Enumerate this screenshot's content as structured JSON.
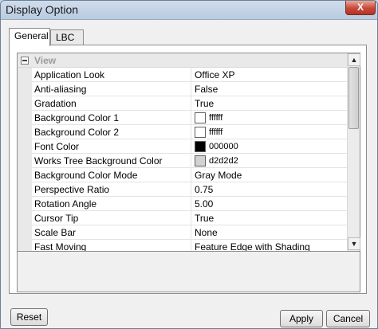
{
  "window": {
    "title": "Display Option",
    "close_label": "X"
  },
  "tabs": [
    {
      "label": "General",
      "active": true
    },
    {
      "label": "LBC",
      "active": false
    }
  ],
  "category": {
    "toggle": "-",
    "label": "View"
  },
  "properties": [
    {
      "name": "Application Look",
      "value": "Office XP"
    },
    {
      "name": "Anti-aliasing",
      "value": "False"
    },
    {
      "name": "Gradation",
      "value": "True"
    },
    {
      "name": "Background Color 1",
      "value": "ffffff",
      "color": "#ffffff"
    },
    {
      "name": "Background Color 2",
      "value": "ffffff",
      "color": "#ffffff"
    },
    {
      "name": "Font Color",
      "value": "000000",
      "color": "#000000"
    },
    {
      "name": "Works Tree Background Color",
      "value": "d2d2d2",
      "color": "#d2d2d2"
    },
    {
      "name": "Background Color Mode",
      "value": "Gray Mode"
    },
    {
      "name": "Perspective Ratio",
      "value": "0.75"
    },
    {
      "name": "Rotation Angle",
      "value": "5.00"
    },
    {
      "name": "Cursor Tip",
      "value": "True"
    },
    {
      "name": "Scale Bar",
      "value": "None"
    },
    {
      "name": "Fast Moving",
      "value": "Feature Edge with Shading"
    }
  ],
  "scrollbar": {
    "up_arrow": "▲",
    "down_arrow": "▼"
  },
  "buttons": {
    "reset": "Reset",
    "apply": "Apply",
    "cancel": "Cancel"
  }
}
